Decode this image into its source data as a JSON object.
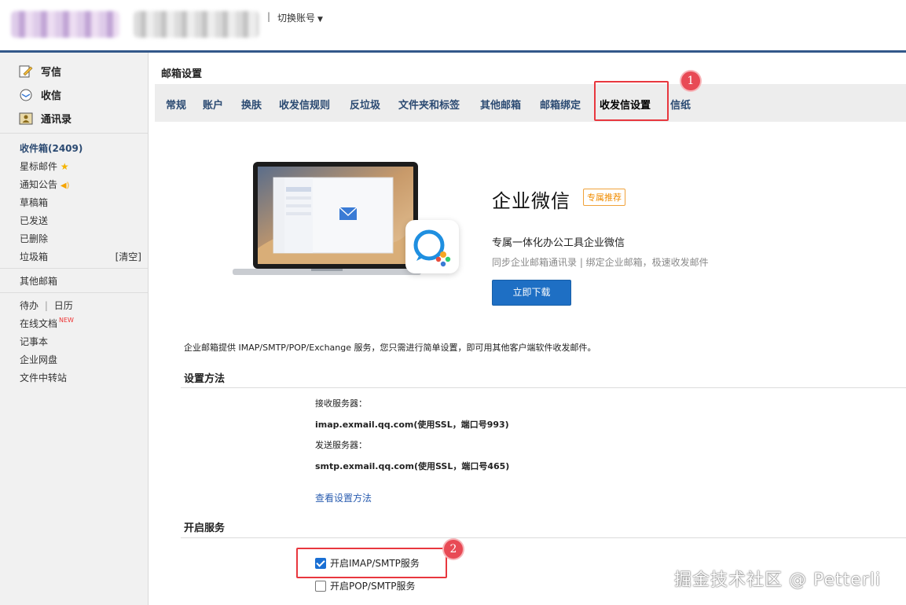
{
  "header": {
    "switch_account": "切换账号",
    "separator": "|"
  },
  "sidebar": {
    "quick_actions": [
      {
        "label": "写信",
        "icon": "compose-icon"
      },
      {
        "label": "收信",
        "icon": "inbox-receive-icon"
      },
      {
        "label": "通讯录",
        "icon": "contacts-icon"
      }
    ],
    "folders": {
      "inbox": "收件箱(2409)",
      "starred": "星标邮件",
      "notice": "通知公告",
      "drafts": "草稿箱",
      "sent": "已发送",
      "deleted": "已删除",
      "spam": "垃圾箱",
      "spam_clear": "[清空]"
    },
    "other_mailbox": "其他邮箱",
    "todo": "待办",
    "calendar": "日历",
    "todo_sep": "|",
    "online_docs": "在线文档",
    "new_badge": "NEW",
    "notes": "记事本",
    "disk": "企业网盘",
    "transfer": "文件中转站"
  },
  "main": {
    "title": "邮箱设置",
    "tabs": [
      "常规",
      "账户",
      "换肤",
      "收发信规则",
      "反垃圾",
      "文件夹和标签",
      "其他邮箱",
      "邮箱绑定",
      "收发信设置",
      "信纸"
    ],
    "active_tab": "收发信设置",
    "badges": {
      "one": "1",
      "two": "2"
    },
    "promo": {
      "title": "企业微信",
      "tag": "专属推荐",
      "subtitle": "专属一体化办公工具企业微信",
      "desc": "同步企业邮箱通讯录 | 绑定企业邮箱，极速收发邮件",
      "download": "立即下载"
    },
    "intro": "企业邮箱提供 IMAP/SMTP/POP/Exchange 服务，您只需进行简单设置，即可用其他客户端软件收发邮件。",
    "setup": {
      "heading": "设置方法",
      "recv_label": "接收服务器：",
      "recv_value": "imap.exmail.qq.com(使用SSL，端口号993)",
      "send_label": "发送服务器：",
      "send_value": "smtp.exmail.qq.com(使用SSL，端口号465)",
      "link": "查看设置方法"
    },
    "services": {
      "heading": "开启服务",
      "imap_label": "开启IMAP/SMTP服务",
      "imap_checked": true,
      "pop_label": "开启POP/SMTP服务",
      "pop_checked": false
    }
  },
  "watermark": "掘金技术社区 @ Petterli",
  "colors": {
    "accent": "#33588a",
    "tab_text": "#2b4a72",
    "highlight": "#e8373e",
    "button": "#1e6fc4"
  }
}
